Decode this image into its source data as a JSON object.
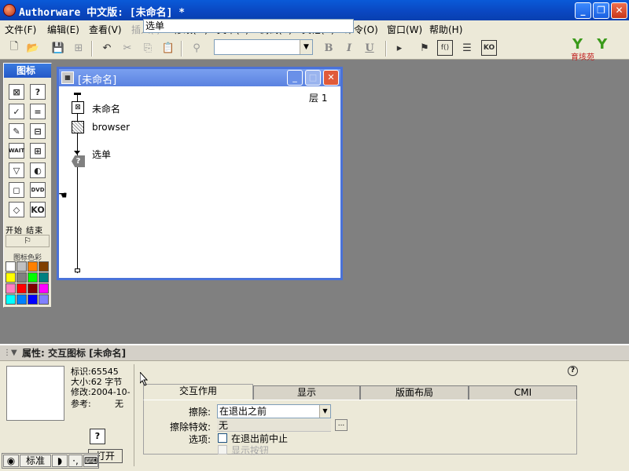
{
  "titlebar": {
    "title": "Authorware 中文版: [未命名] *"
  },
  "menu": [
    {
      "label": "文件(F)",
      "disabled": false
    },
    {
      "label": "编辑(E)",
      "disabled": false
    },
    {
      "label": "查看(V)",
      "disabled": false
    },
    {
      "label": "插入(I)",
      "disabled": true
    },
    {
      "label": "修改(M)",
      "disabled": false
    },
    {
      "label": "文本(T)",
      "disabled": false
    },
    {
      "label": "调试(C)",
      "disabled": false
    },
    {
      "label": "其他(X)",
      "disabled": false
    },
    {
      "label": "命令(O)",
      "disabled": false
    },
    {
      "label": "窗口(W)",
      "disabled": false
    },
    {
      "label": "帮助(H)",
      "disabled": false
    }
  ],
  "toolbar": {
    "bold": "B",
    "italic": "I",
    "underline": "U",
    "font_value": "",
    "logo_letters": "Y Y",
    "logo_text": "育垓苑"
  },
  "palette": {
    "title": "图标",
    "start_end": "开始 结束",
    "color_label": "图标色彩",
    "icons": [
      "display-icon",
      "interaction-icon",
      "calculation-icon",
      "wait-icon",
      "erase-icon",
      "navigate-icon",
      "frame-icon",
      "decision-icon",
      "motion-icon",
      "sound-icon",
      "video-icon",
      "digital-movie-icon",
      "map-icon",
      "knowledge-object-icon"
    ],
    "icon_glyphs": [
      "⊠",
      "?",
      "✓",
      "=",
      "✎",
      "⊟",
      "WAIT",
      "⊞",
      "▽",
      "◐",
      "◻",
      "DVD",
      "◇",
      "KO"
    ],
    "swatches": [
      "#ffffff",
      "#c0c0c0",
      "#ff8000",
      "#804000",
      "#ffff00",
      "#808080",
      "#00ff00",
      "#008080",
      "#ff80c0",
      "#ff0000",
      "#800000",
      "#ff00ff",
      "#00ffff",
      "#0080ff",
      "#0000ff",
      "#8080ff"
    ]
  },
  "flowwin": {
    "title": "[未命名]",
    "layer": "层 1",
    "nodes": [
      {
        "label": "未命名",
        "glyph": "⊠"
      },
      {
        "label": "browser",
        "glyph": "▩"
      },
      {
        "label": "选单",
        "glyph": "?"
      }
    ]
  },
  "props": {
    "header": "属性: 交互图标 [未命名]",
    "id_label": "标识:65545",
    "size_label": "大小:62 字节",
    "modified_label": "修改:2004-10-",
    "ref_label": "参考:",
    "ref_value": "无",
    "name_value": "选单",
    "help": "?",
    "tabs": [
      "交互作用",
      "显示",
      "版面布局",
      "CMI"
    ],
    "erase_label": "擦除:",
    "erase_value": "在退出之前",
    "effect_label": "擦除特效:",
    "effect_value": "无",
    "effect_btn": "...",
    "options_label": "选项:",
    "option1": "在退出前中止",
    "option2": "显示按钮",
    "open_btn": "打开",
    "icon_glyph": "?"
  },
  "ime": {
    "mode": "标准",
    "moon": "◗",
    "punct": "·,",
    "keyboard": "⌨"
  }
}
